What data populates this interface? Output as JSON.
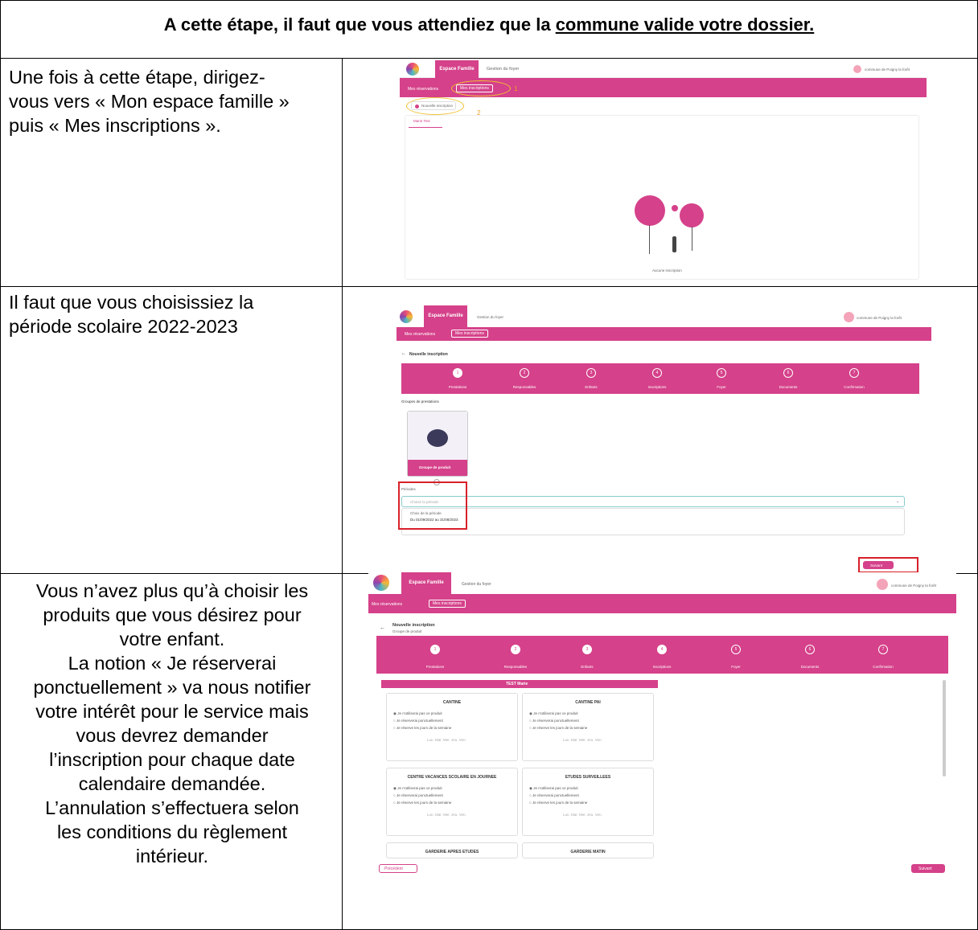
{
  "header": {
    "title_prefix": "A cette étape, il faut que vous attendiez que la ",
    "title_underlined": "commune valide votre dossier."
  },
  "rows": [
    {
      "text_lines": [
        "Une fois à cette étape, dirigez-",
        "vous vers « Mon espace famille »",
        "puis « Mes inscriptions »."
      ]
    },
    {
      "text_lines": [
        "Il faut que vous choisissiez la",
        "période scolaire 2022-2023"
      ]
    },
    {
      "text_lines": [
        "Vous n’avez plus qu’à choisir les",
        "produits que vous désirez pour",
        "votre enfant.",
        "La notion « Je réserverai",
        "ponctuellement » va nous notifier",
        "votre intérêt pour le service mais",
        "vous devrez demander",
        "l’inscription pour chaque date",
        "calendaire demandée.",
        "L’annulation s’effectuera selon",
        "les conditions du règlement",
        "intérieur."
      ]
    }
  ],
  "app": {
    "tab_espace": "Espace Famille",
    "tab_gestion": "Gestion du foyer",
    "commune": "commune de Poigny la forêt",
    "mes_reservations": "Mes réservations",
    "mes_inscriptions": "Mes inscriptions",
    "nouvelle_inscription": "Nouvelle inscription",
    "child_tab": "Marie Test",
    "aucune": "Aucune inscription",
    "annot_1": "1",
    "annot_2": "2",
    "groupes": "Groupes de prestations",
    "groupe_produit": "Groupe de produit",
    "periodes": "Périodes",
    "choisir_periode": "Choisir la période",
    "choix_periode": "Choix de la période",
    "periode_option": "Du 01/09/2022 au 31/08/2023",
    "suivant": "Suivant",
    "precedent": "Précédent",
    "groupe_sub": "Groupe de produit",
    "test_marie": "TEST Marie",
    "steps": [
      "Prestations",
      "Responsables",
      "Enfants",
      "Inscriptions",
      "Foyer",
      "Documents",
      "Confirmation"
    ],
    "products": [
      "CANTINE",
      "CANTINE PAI",
      "CENTRE VACANCES SCOLAIRE EN JOURNEE",
      "ETUDES SURVEILLEES",
      "GARDERIE APRES ETUDES",
      "GARDERIE MATIN"
    ],
    "radio_1": "Je n'utiliserai pas ce produit",
    "radio_2": "Je réserverai ponctuellement",
    "radio_3": "Je réserve les jours de la semaine",
    "days": "Lun.   Mar.   Mer.   Jeu.   Ven."
  },
  "colors": {
    "accent": "#d5418a",
    "highlight_yellow": "#f0c030",
    "highlight_red": "#d8202a"
  }
}
